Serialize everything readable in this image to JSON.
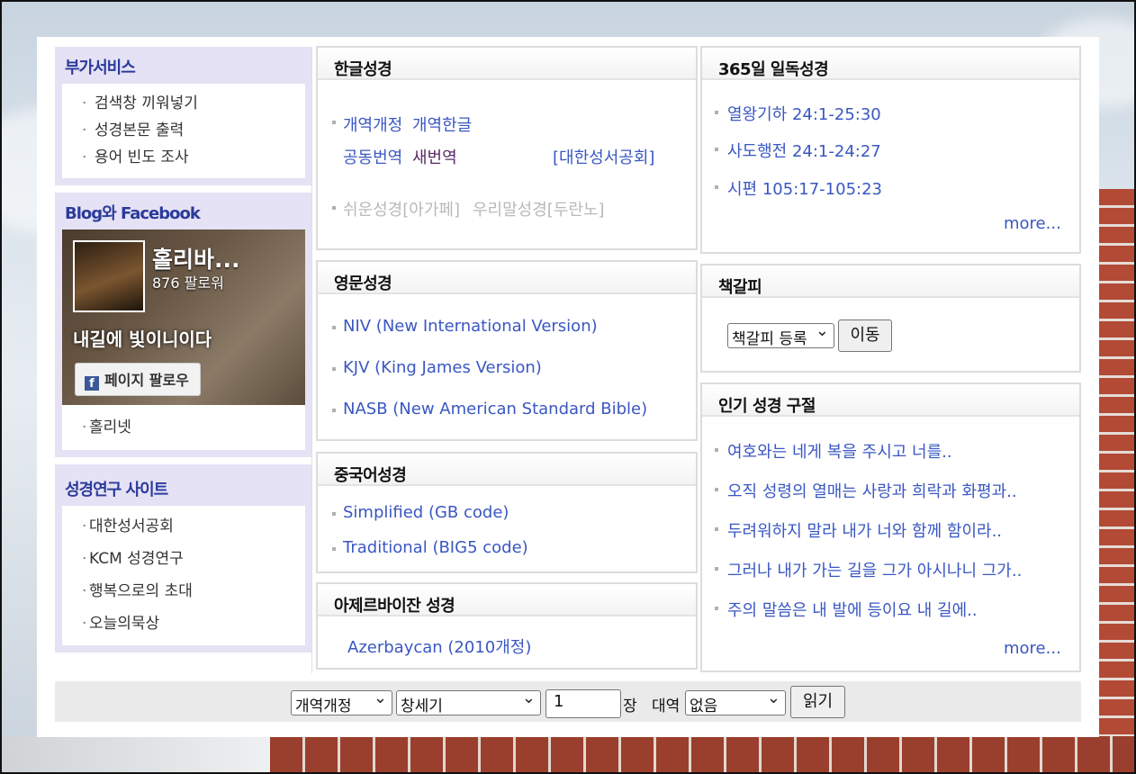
{
  "left": {
    "services": {
      "title": "부가서비스",
      "items": [
        "검색창 끼워넣기",
        "성경본문 출력",
        "용어 빈도 조사"
      ]
    },
    "blog": {
      "title": "Blog와 Facebook",
      "fb_name": "홀리바...",
      "fb_followers": "876 팔로워",
      "fb_art": "내길에 빛이니이다",
      "fb_button": "페이지 팔로우",
      "items": [
        "홀리넷"
      ]
    },
    "study": {
      "title": "성경연구 사이트",
      "items": [
        "대한성서공회",
        "KCM 성경연구",
        "행복으로의 초대",
        "오늘의묵상"
      ]
    }
  },
  "korean": {
    "title": "한글성경",
    "l1": "개역개정",
    "l2": "개역한글",
    "l3": "공동번역",
    "l4": "새번역",
    "l5": "[대한성서공회]",
    "l6": "쉬운성경[아가페]",
    "l7": "우리말성경[두란노]"
  },
  "english": {
    "title": "영문성경",
    "items": [
      "NIV (New International Version)",
      "KJV (King James Version)",
      "NASB (New American Standard Bible)"
    ]
  },
  "chinese": {
    "title": "중국어성경",
    "items": [
      "Simplified (GB code)",
      "Traditional (BIG5 code)"
    ]
  },
  "azer": {
    "title": "아제르바이잔 성경",
    "items": [
      "Azerbaycan (2010개정)"
    ]
  },
  "daily": {
    "title": "365일 일독성경",
    "items": [
      "열왕기하 24:1-25:30",
      "사도행전 24:1-24:27",
      "시편 105:17-105:23"
    ],
    "more": "more..."
  },
  "bookmark": {
    "title": "책갈피",
    "select": "책갈피 등록",
    "button": "이동"
  },
  "popular": {
    "title": "인기 성경 구절",
    "items": [
      "여호와는 네게 복을 주시고 너를..",
      "오직 성령의 열매는 사랑과 희락과 화평과..",
      "두려워하지 말라 내가 너와 함께 함이라..",
      "그러나 내가 가는 길을 그가 아시나니 그가..",
      "주의 말씀은 내 발에 등이요 내 길에.."
    ],
    "more": "more..."
  },
  "footer": {
    "version": "개역개정",
    "book": "창세기",
    "chapter": "1",
    "chapter_unit": "장",
    "parallel_label": "대역",
    "parallel": "없음",
    "read_button": "읽기"
  }
}
